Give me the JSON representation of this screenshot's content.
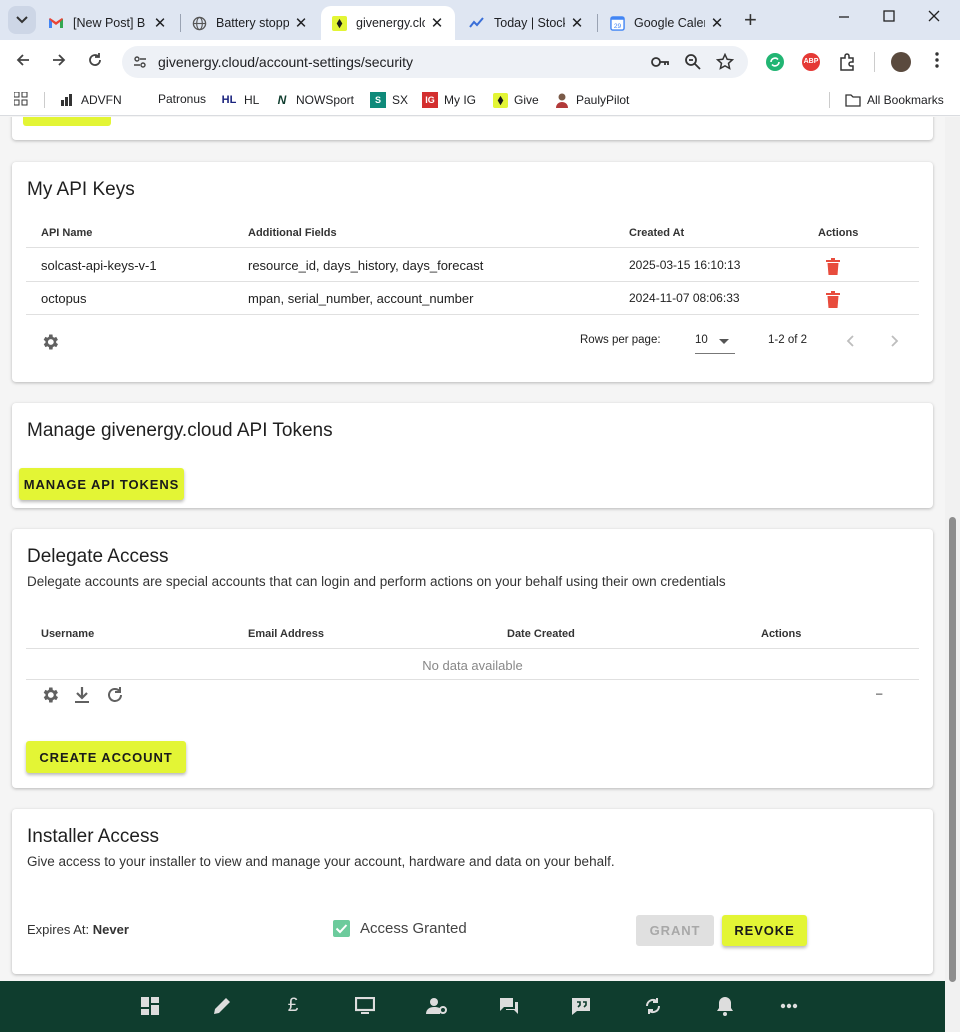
{
  "browser": {
    "tabs": [
      {
        "title": "[New Post] B",
        "icon": "gmail-icon",
        "active": false
      },
      {
        "title": "Battery stopp",
        "icon": "globe-icon",
        "active": false
      },
      {
        "title": "givenergy.clo",
        "icon": "givenergy-icon",
        "active": true
      },
      {
        "title": "Today | Stock",
        "icon": "stock-icon",
        "active": false
      },
      {
        "title": "Google Caler",
        "icon": "calendar-icon",
        "active": false
      }
    ],
    "calendar_icon_number": "29",
    "url": "givenergy.cloud/account-settings/security",
    "bookmarks": [
      {
        "label": "ADVFN",
        "icon": "advfn-icon"
      },
      {
        "label": "Patronus",
        "icon": ""
      },
      {
        "label": "HL",
        "icon": "hl-icon",
        "icon_text": "HL"
      },
      {
        "label": "NOWSport",
        "icon": "nowsport-icon",
        "icon_text": "N"
      },
      {
        "label": "SX",
        "icon": "sx-icon",
        "icon_text": "S"
      },
      {
        "label": "My IG",
        "icon": "ig-icon",
        "icon_text": "IG"
      },
      {
        "label": "Give",
        "icon": "givenergy-icon"
      },
      {
        "label": "PaulyPilot",
        "icon": "avatar-icon"
      }
    ],
    "all_bookmarks": "All Bookmarks",
    "extensions": {
      "abp_text": "ABP"
    }
  },
  "api_keys": {
    "title": "My API Keys",
    "columns": [
      "API Name",
      "Additional Fields",
      "Created At",
      "Actions"
    ],
    "rows": [
      {
        "name": "solcast-api-keys-v-1",
        "fields": "resource_id, days_history, days_forecast",
        "created": "2025-03-15 16:10:13"
      },
      {
        "name": "octopus",
        "fields": "mpan, serial_number, account_number",
        "created": "2024-11-07 08:06:33"
      }
    ],
    "rows_per_page_label": "Rows per page:",
    "rows_per_page": "10",
    "range": "1-2 of 2"
  },
  "tokens": {
    "title": "Manage givenergy.cloud API Tokens",
    "button": "MANAGE API TOKENS"
  },
  "delegate": {
    "title": "Delegate Access",
    "subtitle": "Delegate accounts are special accounts that can login and perform actions on your behalf using their own credentials",
    "columns": [
      "Username",
      "Email Address",
      "Date Created",
      "Actions"
    ],
    "empty": "No data available",
    "range": "–",
    "button": "CREATE ACCOUNT"
  },
  "installer": {
    "title": "Installer Access",
    "subtitle": "Give access to your installer to view and manage your account, hardware and data on your behalf.",
    "expires_label": "Expires At:",
    "expires_value": "Never",
    "access_label": "Access Granted",
    "access_checked": true,
    "grant": "GRANT",
    "revoke": "REVOKE"
  },
  "colors": {
    "accent": "#e3f535",
    "bottombar": "#0f3d2e",
    "delete": "#e84c3d",
    "checkbox": "#6ccb9c"
  },
  "bottom_nav": [
    "dashboard-icon",
    "edit-icon",
    "pound-icon",
    "monitor-icon",
    "account-settings-icon",
    "forum-icon",
    "feedback-icon",
    "sync-icon",
    "bell-icon",
    "more-icon"
  ]
}
